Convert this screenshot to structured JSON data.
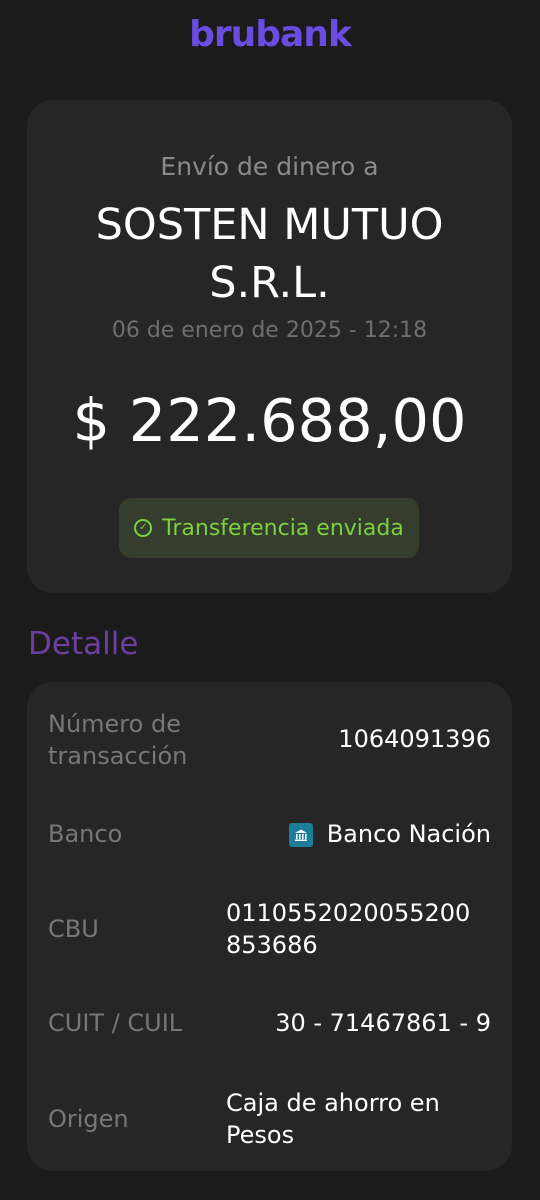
{
  "header": {
    "logo_text": "brubank"
  },
  "summary": {
    "subtitle": "Envío de dinero a",
    "recipient_line1": "SOSTEN MUTUO",
    "recipient_line2": "S.R.L.",
    "datetime": "06 de enero de 2025 - 12:18",
    "amount": "$ 222.688,00",
    "status": "Transferencia enviada"
  },
  "detail": {
    "title": "Detalle",
    "rows": [
      {
        "label_line1": "Número de",
        "label_line2": "transacción",
        "value": "1064091396"
      },
      {
        "label": "Banco",
        "value": "Banco Nación",
        "icon": "bank-icon"
      },
      {
        "label": "CBU",
        "value_line1": "0110552020055200",
        "value_line2": "853686"
      },
      {
        "label": "CUIT / CUIL",
        "value": "30 - 71467861 - 9"
      },
      {
        "label": "Origen",
        "value_line1": "Caja de ahorro en",
        "value_line2": "Pesos"
      }
    ]
  },
  "colors": {
    "background": "#1b1b1b",
    "card": "#262626",
    "brand": "#6a4de0",
    "success": "#7cd13f",
    "section_title": "#6b3fa0"
  }
}
